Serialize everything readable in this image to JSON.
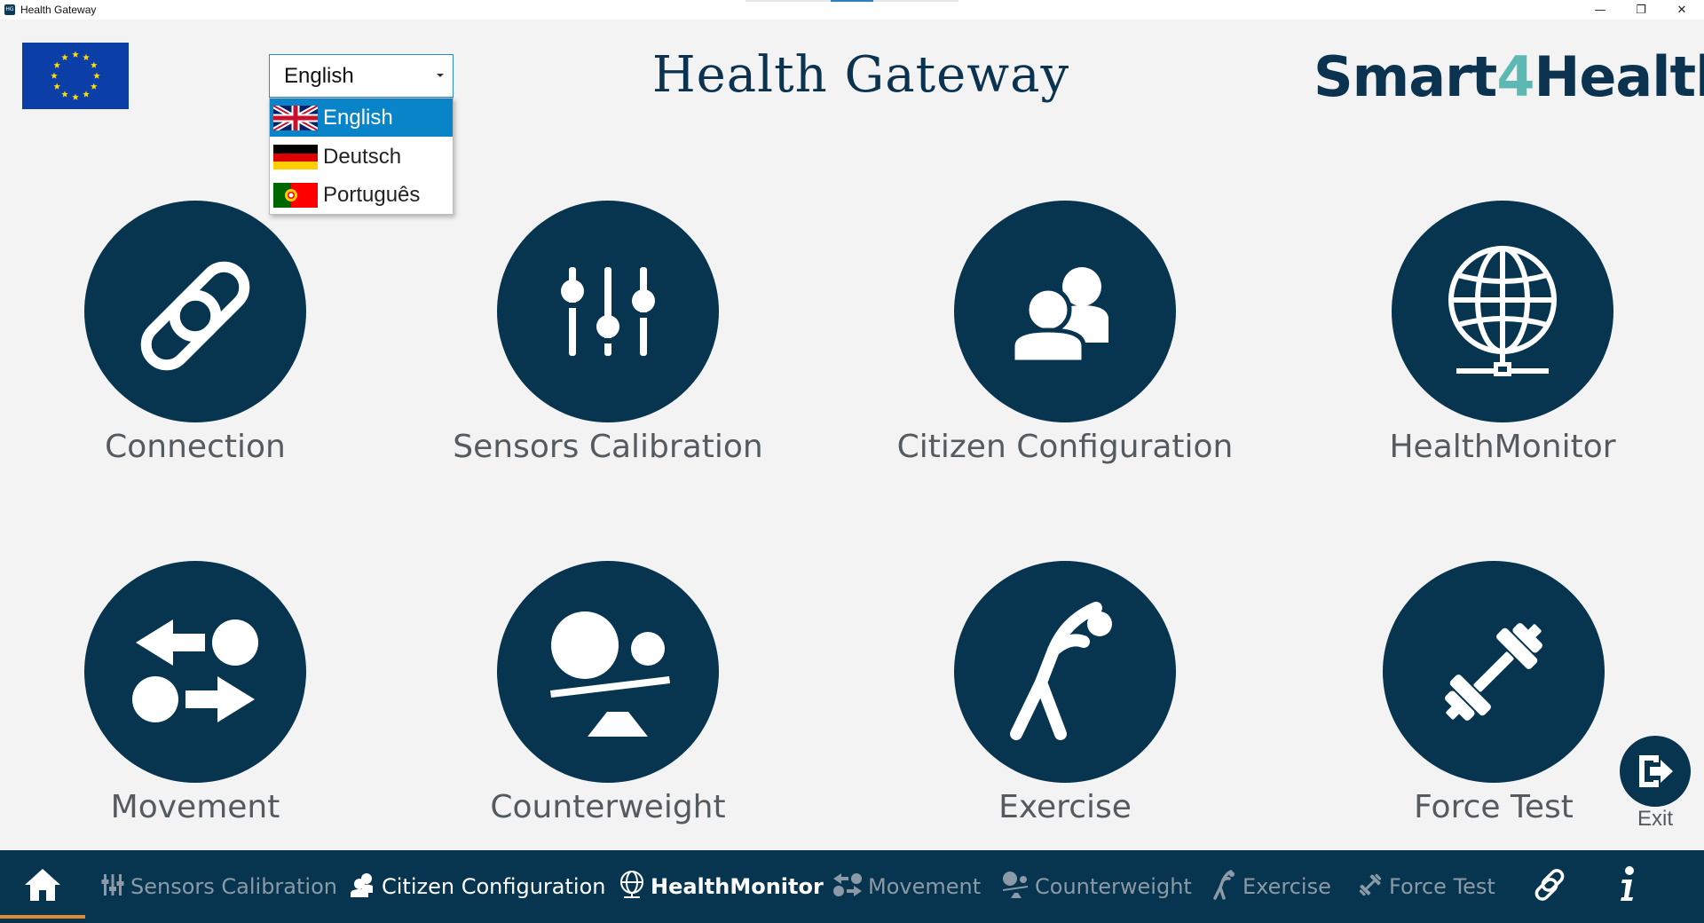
{
  "window": {
    "title": "Health Gateway",
    "app_icon": "HG",
    "minimize_glyph": "—",
    "restore_glyph": "❐",
    "close_glyph": "✕"
  },
  "header": {
    "title": "Health Gateway",
    "brand_part1": "Smart",
    "brand_part2": "4",
    "brand_part3": "Health",
    "brand_color": "#0b3350",
    "brand_accent": "#5cb8b2"
  },
  "language": {
    "selected": "English",
    "options": [
      {
        "label": "English",
        "flag": "uk-flag-icon"
      },
      {
        "label": "Deutsch",
        "flag": "germany-flag-icon"
      },
      {
        "label": "Português",
        "flag": "portugal-flag-icon"
      }
    ]
  },
  "tiles": [
    {
      "label": "Connection",
      "icon": "chain-link-icon"
    },
    {
      "label": "Sensors Calibration",
      "icon": "sliders-icon"
    },
    {
      "label": "Citizen Configuration",
      "icon": "users-icon"
    },
    {
      "label": "HealthMonitor",
      "icon": "globe-network-icon"
    },
    {
      "label": "Movement",
      "icon": "arrows-exchange-icon"
    },
    {
      "label": "Counterweight",
      "icon": "balance-icon"
    },
    {
      "label": "Exercise",
      "icon": "stretching-person-icon"
    },
    {
      "label": "Force Test",
      "icon": "dumbbell-icon"
    }
  ],
  "exit": {
    "label": "Exit",
    "icon": "exit-icon"
  },
  "bottom_nav": {
    "items": [
      {
        "label": "",
        "icon": "home-icon",
        "state": "active"
      },
      {
        "label": "Sensors Calibration",
        "icon": "sliders-icon",
        "state": "disabled"
      },
      {
        "label": "Citizen Configuration",
        "icon": "users-icon",
        "state": "enabled"
      },
      {
        "label": "HealthMonitor",
        "icon": "globe-network-icon",
        "state": "enabled"
      },
      {
        "label": "Movement",
        "icon": "arrows-exchange-icon",
        "state": "disabled"
      },
      {
        "label": "Counterweight",
        "icon": "balance-icon",
        "state": "disabled"
      },
      {
        "label": "Exercise",
        "icon": "stretching-person-icon",
        "state": "disabled"
      },
      {
        "label": "Force Test",
        "icon": "dumbbell-icon",
        "state": "disabled"
      },
      {
        "label": "",
        "icon": "chain-link-icon",
        "state": "enabled"
      },
      {
        "label": "",
        "icon": "info-icon",
        "state": "enabled"
      }
    ],
    "accent": "#e08a32",
    "background": "#07344f"
  }
}
